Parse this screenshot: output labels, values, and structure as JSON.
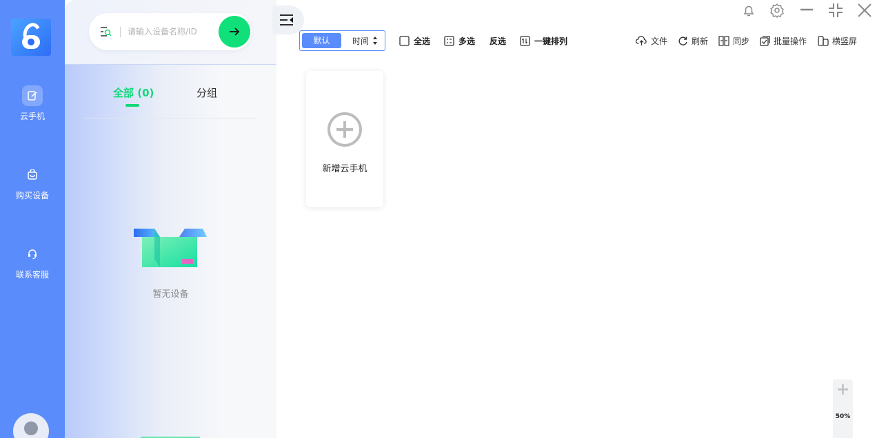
{
  "nav": {
    "items": [
      {
        "label": "云手机",
        "icon": "cloud-phone-icon"
      },
      {
        "label": "购买设备",
        "icon": "shopping-bag-icon"
      },
      {
        "label": "联系客服",
        "icon": "headset-icon"
      }
    ]
  },
  "panel": {
    "search_placeholder": "请输入设备名称/ID",
    "tabs": [
      {
        "label": "全部 (0)"
      },
      {
        "label": "分组"
      }
    ],
    "empty_text": "暂无设备"
  },
  "toolbar": {
    "sort_default": "默认",
    "sort_time": "时间",
    "select_all": "全选",
    "multi_select": "多选",
    "invert_select": "反选",
    "one_key_sort": "一键排列",
    "upload_file": "文件",
    "refresh": "刷新",
    "sync": "同步",
    "batch": "批量操作",
    "orientation": "横竖屏"
  },
  "main": {
    "add_card_label": "新增云手机"
  },
  "zoom": {
    "level": "50%"
  },
  "colors": {
    "rail": "#5b8cfb",
    "accent_green": "#12d979",
    "go_button": "#0fe07a",
    "sort_active": "#5b8cfb"
  }
}
